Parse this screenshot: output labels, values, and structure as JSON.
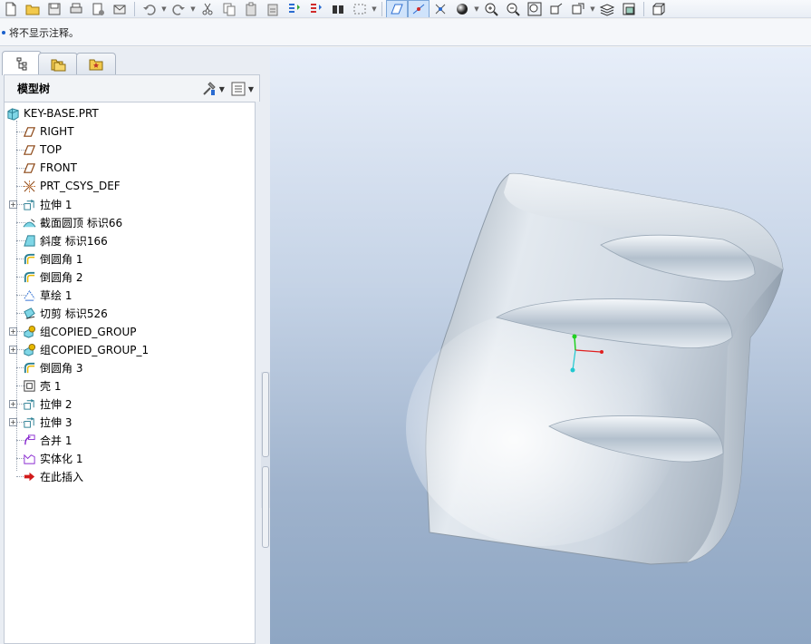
{
  "toolbar": {
    "buttons": [
      "new-file-icon",
      "open-folder-icon",
      "save-icon",
      "print-icon",
      "page-setup-icon",
      "email-icon",
      "undo-icon",
      "redo-icon",
      "cut-icon",
      "copy-icon",
      "paste-icon",
      "paste-special-icon",
      "regenerate-icon",
      "regen-manager-icon",
      "find-icon",
      "select-box-icon",
      "datum-display-icon",
      "axis-display-icon",
      "point-display-icon",
      "csys-display-icon",
      "shade-sphere-icon",
      "zoom-in-icon",
      "zoom-out-icon",
      "refit-icon",
      "reorient-icon",
      "saved-views-icon",
      "layers-icon",
      "view-manager-icon",
      "orthographic-icon"
    ]
  },
  "message": {
    "text": "将不显示注释。"
  },
  "left_panel": {
    "tabs": [
      "model-tree-tab",
      "folder-browser-tab",
      "favorites-tab"
    ],
    "tree_title": "模型树",
    "nodes": [
      {
        "label": "KEY-BASE.PRT",
        "icon": "part-icon"
      },
      {
        "label": "RIGHT",
        "icon": "datum-plane-icon"
      },
      {
        "label": "TOP",
        "icon": "datum-plane-icon"
      },
      {
        "label": "FRONT",
        "icon": "datum-plane-icon"
      },
      {
        "label": "PRT_CSYS_DEF",
        "icon": "csys-icon"
      },
      {
        "label": "拉伸 1",
        "icon": "extrude-icon",
        "expandable": true
      },
      {
        "label": "截面圆顶 标识66",
        "icon": "dome-icon"
      },
      {
        "label": "斜度 标识166",
        "icon": "draft-icon"
      },
      {
        "label": "倒圆角 1",
        "icon": "round-icon"
      },
      {
        "label": "倒圆角 2",
        "icon": "round-icon"
      },
      {
        "label": "草绘 1",
        "icon": "sketch-icon"
      },
      {
        "label": "切剪 标识526",
        "icon": "cut-icon"
      },
      {
        "label": "组COPIED_GROUP",
        "icon": "group-icon",
        "expandable": true
      },
      {
        "label": "组COPIED_GROUP_1",
        "icon": "group-icon",
        "expandable": true
      },
      {
        "label": "倒圆角 3",
        "icon": "round-icon"
      },
      {
        "label": "壳 1",
        "icon": "shell-icon"
      },
      {
        "label": "拉伸 2",
        "icon": "extrude-icon",
        "expandable": true
      },
      {
        "label": "拉伸 3",
        "icon": "extrude-icon",
        "expandable": true
      },
      {
        "label": "合并 1",
        "icon": "merge-icon"
      },
      {
        "label": "实体化 1",
        "icon": "solidify-icon"
      },
      {
        "label": "在此插入",
        "icon": "insert-here-arrow-icon"
      }
    ]
  },
  "colors": {
    "viewport_top": "#e7eef9",
    "viewport_bottom": "#8ea6c3",
    "model_surface": "#c9d4df",
    "csys_x": "#e02020",
    "csys_y": "#20d020",
    "csys_z": "#20c8d0"
  }
}
